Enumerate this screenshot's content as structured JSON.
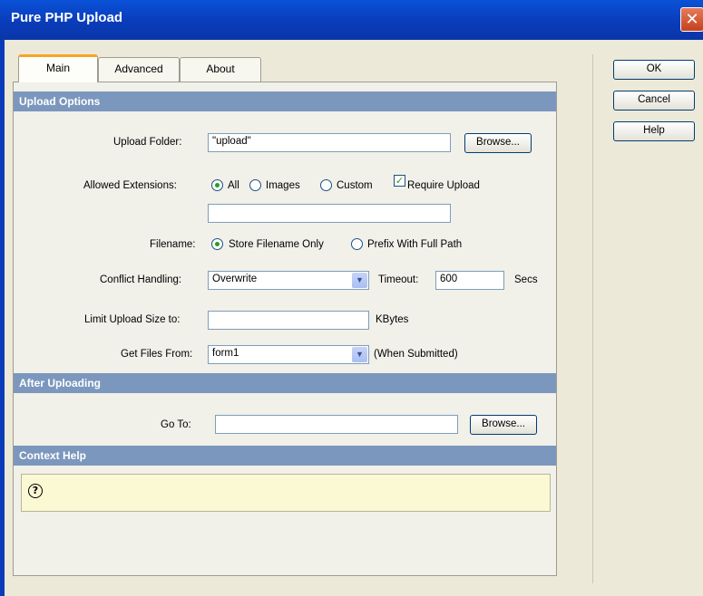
{
  "window": {
    "title": "Pure PHP Upload",
    "close": "✕"
  },
  "tabs": [
    {
      "label": "Main"
    },
    {
      "label": "Advanced"
    },
    {
      "label": "About"
    }
  ],
  "buttons": {
    "ok": "OK",
    "cancel": "Cancel",
    "help": "Help"
  },
  "upload_options": {
    "header": "Upload Options",
    "folder_label": "Upload Folder:",
    "folder_value": "\"upload\"",
    "browse": "Browse...",
    "extensions_label": "Allowed Extensions:",
    "ext_all": "All",
    "ext_images": "Images",
    "ext_custom": "Custom",
    "ext_selected": "All",
    "require_upload": "Require Upload",
    "require_upload_checked": true,
    "custom_ext_value": "",
    "filename_label": "Filename:",
    "filename_store": "Store Filename Only",
    "filename_prefix": "Prefix With Full Path",
    "filename_selected": "Store Filename Only",
    "conflict_label": "Conflict Handling:",
    "conflict_value": "Overwrite",
    "timeout_label": "Timeout:",
    "timeout_value": "600",
    "timeout_unit": "Secs",
    "limit_label": "Limit Upload Size to:",
    "limit_value": "",
    "limit_unit": "KBytes",
    "getfiles_label": "Get Files From:",
    "getfiles_value": "form1",
    "getfiles_note": "(When Submitted)"
  },
  "after_uploading": {
    "header": "After Uploading",
    "goto_label": "Go To:",
    "goto_value": "",
    "browse": "Browse..."
  },
  "context_help": {
    "header": "Context Help",
    "icon": "?"
  },
  "colors": {
    "title_bar": "#0a3cba",
    "section_header": "#7b97bd",
    "dialog_bg": "#ece9d8",
    "active_tab_accent": "#f5a623",
    "help_bg": "#fbf8d4"
  }
}
